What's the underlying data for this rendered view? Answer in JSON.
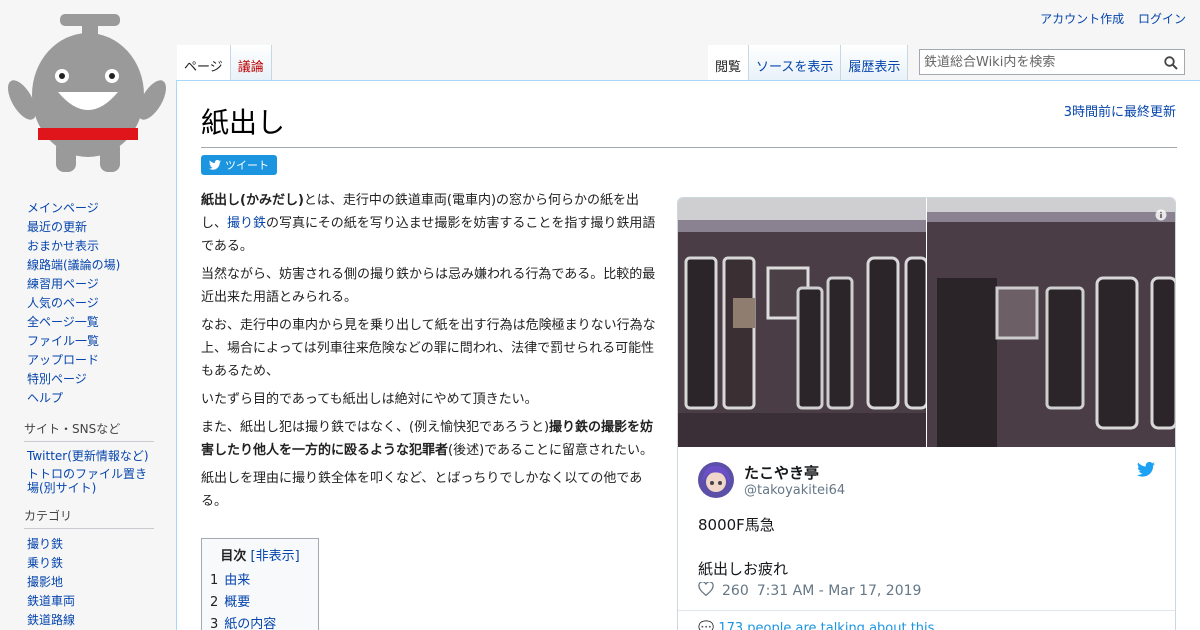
{
  "personal": {
    "create_account": "アカウント作成",
    "login": "ログイン"
  },
  "tabs": {
    "left": [
      {
        "label": "ページ",
        "selected": true
      },
      {
        "label": "議論",
        "new": true
      }
    ],
    "right": [
      {
        "label": "閲覧",
        "selected": true
      },
      {
        "label": "ソースを表示"
      },
      {
        "label": "履歴表示"
      }
    ]
  },
  "search": {
    "placeholder": "鉄道総合Wiki内を検索"
  },
  "sidebar": {
    "nav": [
      "メインページ",
      "最近の更新",
      "おまかせ表示",
      "線路端(議論の場)",
      "練習用ページ",
      "人気のページ",
      "全ページ一覧",
      "ファイル一覧",
      "アップロード",
      "特別ページ",
      "ヘルプ"
    ],
    "site_heading": "サイト・SNSなど",
    "site_items": [
      "Twitter(更新情報など)",
      "トトロのファイル置き場(別サイト)"
    ],
    "cat_heading": "カテゴリ",
    "cat_items": [
      "撮り鉄",
      "乗り鉄",
      "撮影地",
      "鉄道車両",
      "鉄道路線"
    ]
  },
  "page": {
    "title": "紙出し",
    "last_modified": "3時間前に最終更新",
    "tweet_button": "ツイート",
    "p1_bold": "紙出し(かみだし)",
    "p1_a": "とは、走行中の鉄道車両(電車内)の窓から何らかの紙を出し、",
    "p1_link": "撮り鉄",
    "p1_b": "の写真にその紙を写り込ませ撮影を妨害することを指す撮り鉄用語である。",
    "p2": "当然ながら、妨害される側の撮り鉄からは忌み嫌われる行為である。比較的最近出来た用語とみられる。",
    "p3": "なお、走行中の車内から見を乗り出して紙を出す行為は危険極まりない行為な上、場合によっては列車往来危険などの罪に問われ、法律で罰せられる可能性もあるため、",
    "p4": "いたずら目的であっても紙出しは絶対にやめて頂きたい。",
    "p5_a": "また、紙出し犯は撮り鉄ではなく、(例え愉快犯であろうと)",
    "p5_bold": "撮り鉄の撮影を妨害したり他人を一方的に殴るような犯罪者",
    "p5_b": "(後述)であることに留意されたい。",
    "p6": "紙出しを理由に撮り鉄全体を叩くなど、とばっちりでしかなく以ての他である。"
  },
  "toc": {
    "title": "目次",
    "toggle": "[非表示]",
    "items": [
      {
        "num": "1",
        "label": "由来"
      },
      {
        "num": "2",
        "label": "概要"
      },
      {
        "num": "3",
        "label": "紙の内容"
      }
    ]
  },
  "tweet": {
    "name": "たこやき亭",
    "handle": "@takoyakitei64",
    "text_line1": "8000F馬急",
    "text_line2": "紙出しお疲れ",
    "likes": "260",
    "time": "7:31 AM - Mar 17, 2019",
    "footer": "173 people are talking about this"
  },
  "colors": {
    "link": "#0645ad",
    "new_link": "#ba0000",
    "twitter_blue": "#1b95e0",
    "train_body": "#4a3d45"
  }
}
